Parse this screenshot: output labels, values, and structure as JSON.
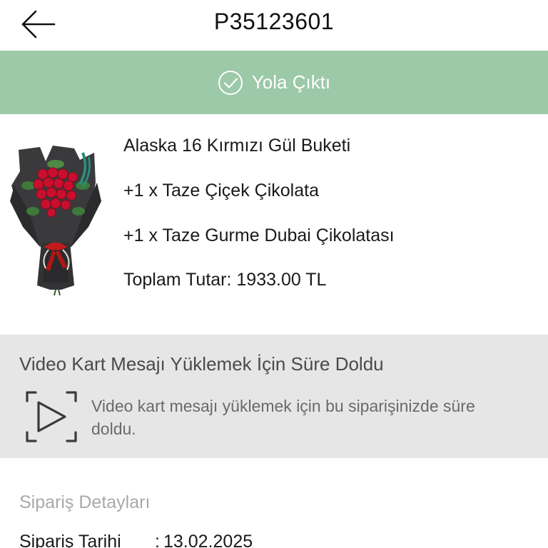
{
  "header": {
    "order_code": "P35123601",
    "back_icon": "arrow-left-icon"
  },
  "status": {
    "label": "Yola Çıktı",
    "icon": "check-circle-icon",
    "color": "#9cc9a8"
  },
  "product": {
    "image_icon": "rose-bouquet-image",
    "lines": [
      "Alaska 16 Kırmızı Gül Buketi",
      "+1 x Taze Çiçek Çikolata",
      "+1 x Taze Gurme Dubai Çikolatası",
      "Toplam Tutar: 1933.00 TL"
    ]
  },
  "video_card": {
    "title": "Video Kart Mesajı Yüklemek İçin Süre Doldu",
    "description": "Video kart mesajı yüklemek için bu siparişinizde süre doldu.",
    "icon": "video-play-frame-icon"
  },
  "details": {
    "heading": "Sipariş Detayları",
    "rows": [
      {
        "label": "Sipariş Tarihi",
        "separator": ":",
        "value": "13.02.2025"
      }
    ]
  }
}
